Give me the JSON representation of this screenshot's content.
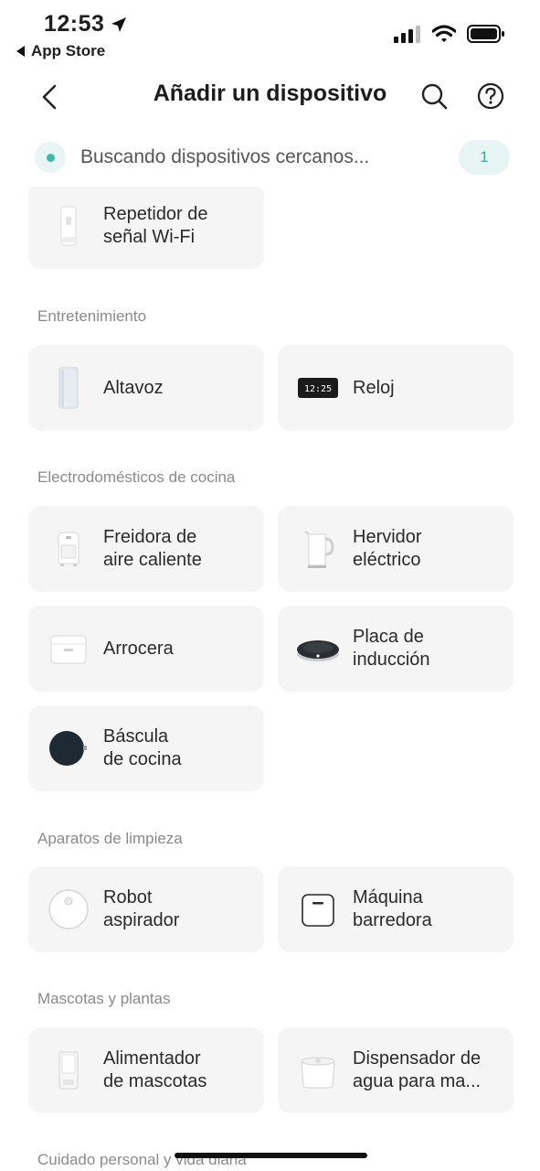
{
  "status_bar": {
    "time": "12:53",
    "back_app": "App Store"
  },
  "header": {
    "title": "Añadir un dispositivo"
  },
  "scan": {
    "text": "Buscando dispositivos cercanos...",
    "count": "1"
  },
  "sections": {
    "top": {
      "items": [
        {
          "label": "Repetidor de\nseñal Wi-Fi",
          "icon": "wifi-repeater-icon"
        }
      ]
    },
    "entertainment": {
      "title": "Entretenimiento",
      "items": [
        {
          "label": "Altavoz",
          "icon": "speaker-icon"
        },
        {
          "label": "Reloj",
          "icon": "clock-icon",
          "clock_text": "12:25"
        }
      ]
    },
    "kitchen": {
      "title": "Electrodomésticos de cocina",
      "items": [
        {
          "label": "Freidora de\naire caliente",
          "icon": "air-fryer-icon"
        },
        {
          "label": "Hervidor\neléctrico",
          "icon": "kettle-icon"
        },
        {
          "label": "Arrocera",
          "icon": "rice-cooker-icon"
        },
        {
          "label": "Placa de\ninducción",
          "icon": "induction-cooker-icon"
        },
        {
          "label": "Báscula\nde cocina",
          "icon": "kitchen-scale-icon"
        }
      ]
    },
    "cleaning": {
      "title": "Aparatos de limpieza",
      "items": [
        {
          "label": "Robot\naspirador",
          "icon": "robot-vacuum-icon"
        },
        {
          "label": "Máquina\nbarredora",
          "icon": "sweeper-icon"
        }
      ]
    },
    "pets": {
      "title": "Mascotas y plantas",
      "items": [
        {
          "label": "Alimentador\nde mascotas",
          "icon": "pet-feeder-icon"
        },
        {
          "label": "Dispensador de\nagua para ma...",
          "icon": "water-dispenser-icon"
        }
      ]
    },
    "personal": {
      "title": "Cuidado personal y vida diaria"
    }
  },
  "colors": {
    "accent": "#41b6ad",
    "card_bg": "#f5f5f5",
    "section_text": "#8a8a8a"
  }
}
